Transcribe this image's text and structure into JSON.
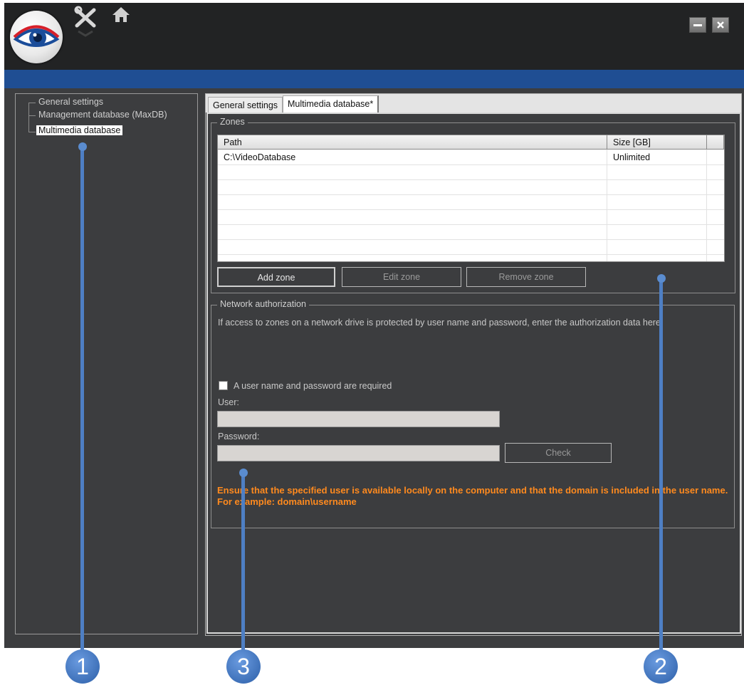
{
  "header": {
    "logo_icon": "eye-logo-icon",
    "tools_icon": "tools-icon",
    "home_icon": "home-icon",
    "minimize_icon": "minimize-icon",
    "close_icon": "close-icon"
  },
  "tree": {
    "items": [
      {
        "label": "General settings"
      },
      {
        "label": "Management database (MaxDB)"
      },
      {
        "label": "Multimedia database",
        "selected": true
      }
    ]
  },
  "tabs": [
    {
      "label": "General settings"
    },
    {
      "label": "Multimedia database*",
      "active": true
    }
  ],
  "zones": {
    "legend": "Zones",
    "columns": [
      "Path",
      "Size [GB]"
    ],
    "rows": [
      {
        "path": "C:\\VideoDatabase",
        "size": "Unlimited"
      }
    ],
    "buttons": {
      "add": "Add zone",
      "edit": "Edit zone",
      "remove": "Remove zone"
    }
  },
  "network": {
    "legend": "Network authorization",
    "description": "If access to zones on a network drive is protected by user name and password, enter the authorization data here.",
    "checkbox_label": "A user name and password are required",
    "user_label": "User:",
    "user_value": "",
    "password_label": "Password:",
    "password_value": "",
    "check_button": "Check",
    "warning": "Ensure that the specified user is available locally on the computer and that the domain is included in the user name. For example: domain\\username"
  },
  "callouts": [
    "1",
    "2",
    "3"
  ],
  "colors": {
    "header_bg": "#222324",
    "band": "#1f4e93",
    "panel_bg": "#3c3d3f",
    "warning": "#ff8a1e",
    "callout": "#4e7fc4"
  }
}
